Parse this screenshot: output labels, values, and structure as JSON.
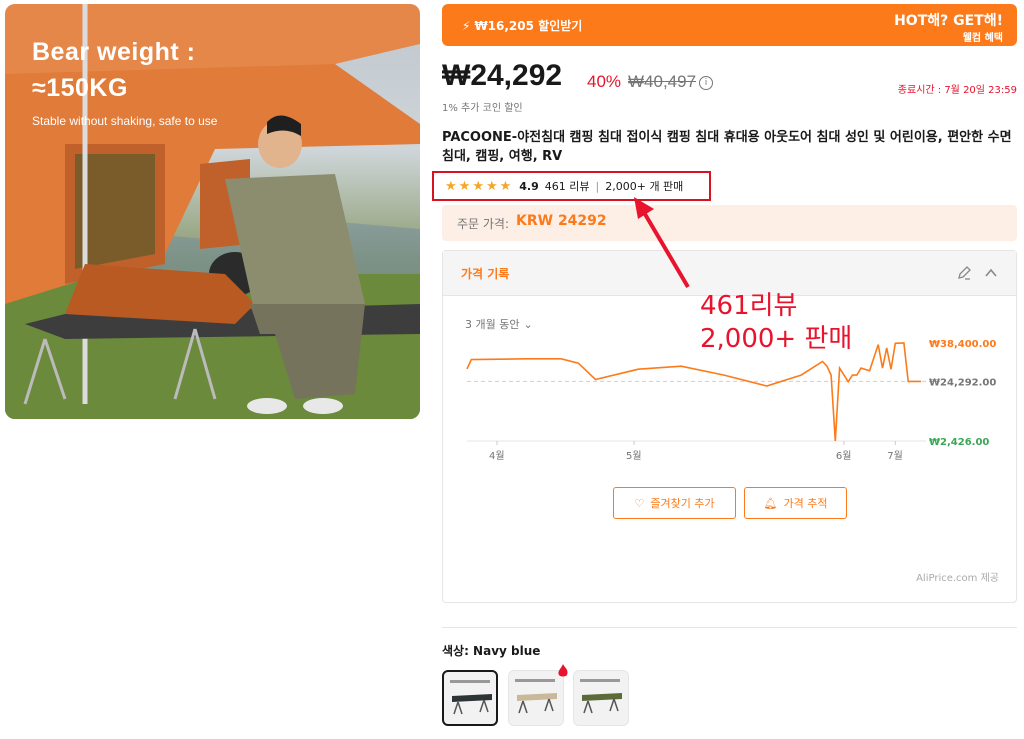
{
  "hero": {
    "title_line1": "Bear weight :",
    "title_line2": "≈150KG",
    "subtitle": "Stable without shaking, safe to use"
  },
  "promo": {
    "coupon": "₩16,205 할인받기",
    "headline": "HOT해? GET해!",
    "sub": "웰컴 혜택",
    "bg_color": "#fd7a1a"
  },
  "price": {
    "current": "₩24,292",
    "discount": "40%",
    "original": "₩40,497",
    "coin_note": "1% 추가 코인 할인",
    "end_time": "종료시간 : 7월 20일 23:59"
  },
  "product": {
    "title": "PACOONE-야전침대 캠핑 침대 접이식 캠핑 침대 휴대용 아웃도어 침대 성인 및 어린이용, 편안한 수면 침대, 캠핑, 여행, RV"
  },
  "rating": {
    "stars": 5,
    "score": "4.9",
    "reviews": "461 리뷰",
    "sold": "2,000+ 개 판매",
    "star_color": "#f5a623"
  },
  "order_price": {
    "label": "주문 가격:",
    "value": "KRW 24292"
  },
  "price_history": {
    "title": "가격 기록",
    "range": "3 개월 동안",
    "favorite_button": "즐겨찾기 추가",
    "track_button": "가격 추적",
    "credit": "AliPrice.com 제공"
  },
  "chart_data": {
    "type": "line",
    "title": "",
    "xlabel": "",
    "ylabel": "",
    "x_ticks": [
      "4월",
      "5월",
      "6월",
      "7월"
    ],
    "y_markers": [
      {
        "label": "₩38,400.00",
        "value": 38400,
        "color": "#fd7a1a"
      },
      {
        "label": "₩24,292.00",
        "value": 24292,
        "color": "#757575"
      },
      {
        "label": "₩2,426.00",
        "value": 2426,
        "color": "#3aa757"
      }
    ],
    "ylim": [
      2426,
      38400
    ],
    "x_range_days": [
      0,
      106
    ],
    "series": [
      {
        "color": "#fd7a1a",
        "points": [
          [
            0,
            28900
          ],
          [
            1,
            32300
          ],
          [
            14,
            32600
          ],
          [
            22,
            32600
          ],
          [
            26,
            31000
          ],
          [
            30,
            25000
          ],
          [
            40,
            28800
          ],
          [
            50,
            29900
          ],
          [
            60,
            26600
          ],
          [
            70,
            22600
          ],
          [
            78,
            26600
          ],
          [
            83,
            31600
          ],
          [
            84,
            30000
          ],
          [
            85,
            26600
          ],
          [
            86,
            2426
          ],
          [
            87,
            29200
          ],
          [
            89,
            24200
          ],
          [
            90,
            26600
          ],
          [
            91,
            26600
          ],
          [
            92,
            29200
          ],
          [
            94,
            28200
          ],
          [
            96,
            37800
          ],
          [
            97,
            29200
          ],
          [
            98,
            36600
          ],
          [
            99,
            28800
          ],
          [
            100,
            38300
          ],
          [
            102,
            38400
          ],
          [
            103,
            24292
          ],
          [
            106,
            24292
          ]
        ]
      }
    ],
    "reference_line": 24292,
    "grid": false,
    "legend": "none"
  },
  "color_option": {
    "label": "색상: Navy blue",
    "swatches": [
      {
        "name": "Navy blue",
        "selected": true,
        "frame": "#2d3436"
      },
      {
        "name": "Beige",
        "selected": false,
        "frame": "#c9b89a"
      },
      {
        "name": "Army green",
        "selected": false,
        "frame": "#5b6b3a"
      }
    ]
  },
  "annotation": {
    "line1": "461리뷰",
    "line2": "2,000+ 판매",
    "color": "#e8132d"
  }
}
